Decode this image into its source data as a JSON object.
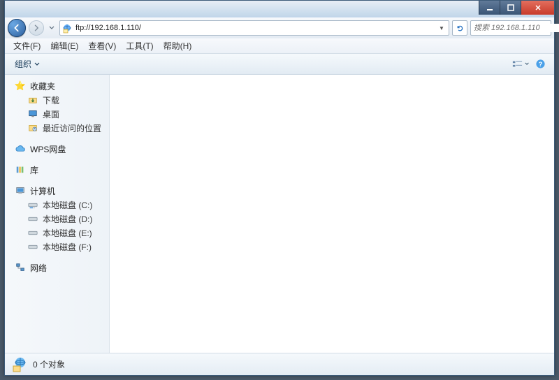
{
  "address": {
    "url": "ftp://192.168.1.110/"
  },
  "search": {
    "placeholder": "搜索 192.168.1.110"
  },
  "menu": {
    "file": "文件(F)",
    "edit": "编辑(E)",
    "view": "查看(V)",
    "tools": "工具(T)",
    "help": "帮助(H)"
  },
  "toolbar": {
    "organize": "组织"
  },
  "sidebar": {
    "favorites": {
      "label": "收藏夹",
      "items": [
        "下载",
        "桌面",
        "最近访问的位置"
      ]
    },
    "wps": {
      "label": "WPS网盘"
    },
    "libraries": {
      "label": "库"
    },
    "computer": {
      "label": "计算机",
      "items": [
        "本地磁盘 (C:)",
        "本地磁盘 (D:)",
        "本地磁盘 (E:)",
        "本地磁盘 (F:)"
      ]
    },
    "network": {
      "label": "网络"
    }
  },
  "status": {
    "count": "0 个对象"
  }
}
